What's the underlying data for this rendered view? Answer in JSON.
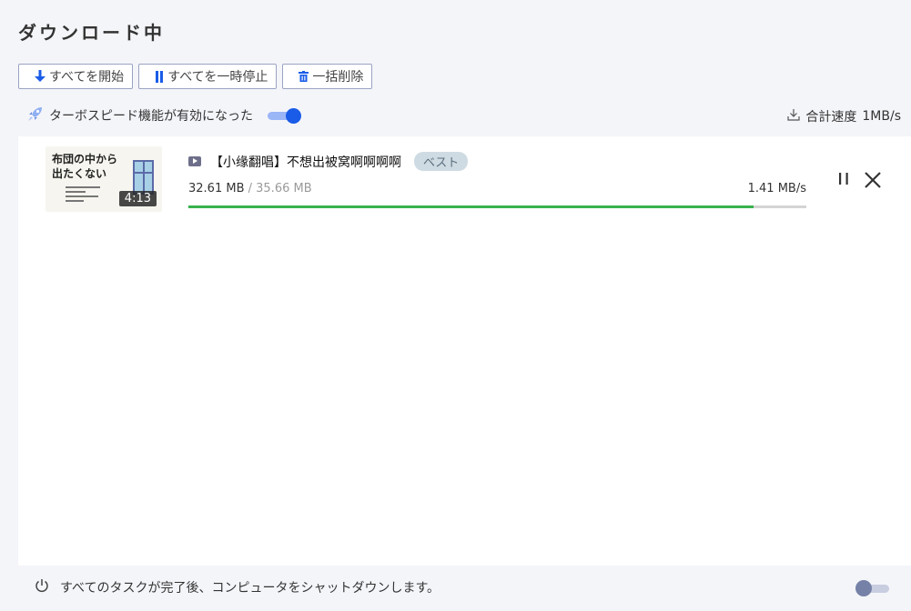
{
  "header": {
    "title": "ダウンロード中"
  },
  "toolbar": {
    "start_all": "すべてを開始",
    "pause_all": "すべてを一時停止",
    "delete_all": "一括削除"
  },
  "turbo": {
    "label": "ターボスピード機能が有効になった",
    "enabled": true
  },
  "total_speed": {
    "label": "合計速度",
    "value": "1MB/s"
  },
  "downloads": [
    {
      "thumbnail_text": "布団の中から\n出たくない",
      "duration": "4:13",
      "title": "【小缘翻唱】不想出被窝啊啊啊啊",
      "badge": "ベスト",
      "downloaded": "32.61 MB",
      "separator": " / ",
      "total": "35.66 MB",
      "speed": "1.41 MB/s",
      "progress": 0.914
    }
  ],
  "footer": {
    "shutdown_label": "すべてのタスクが完了後、コンピュータをシャットダウンします。",
    "shutdown_enabled": false
  },
  "colors": {
    "accent": "#1a5ce8",
    "progress": "#37b24d"
  }
}
